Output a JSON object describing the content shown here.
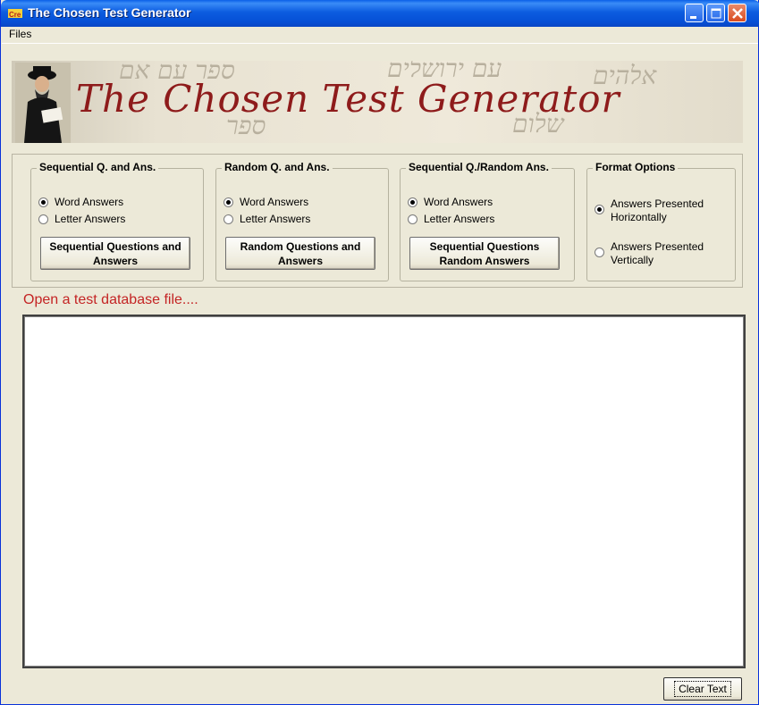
{
  "window": {
    "title": "The Chosen Test Generator"
  },
  "menu": {
    "files": "Files"
  },
  "banner": {
    "title": "The Chosen Test Generator"
  },
  "groups": [
    {
      "legend": "Sequential Q. and Ans.",
      "options": [
        {
          "label": "Word Answers",
          "selected": true
        },
        {
          "label": "Letter Answers",
          "selected": false
        }
      ],
      "button": "Sequential Questions and Answers"
    },
    {
      "legend": "Random Q. and Ans.",
      "options": [
        {
          "label": "Word Answers",
          "selected": true
        },
        {
          "label": "Letter Answers",
          "selected": false
        }
      ],
      "button": "Random Questions and Answers"
    },
    {
      "legend": "Sequential Q./Random Ans.",
      "options": [
        {
          "label": "Word Answers",
          "selected": true
        },
        {
          "label": "Letter Answers",
          "selected": false
        }
      ],
      "button": "Sequential Questions Random Answers"
    }
  ],
  "format": {
    "legend": "Format Options",
    "options": [
      {
        "label": "Answers Presented Horizontally",
        "selected": true
      },
      {
        "label": "Answers Presented Vertically",
        "selected": false
      }
    ]
  },
  "status": "Open a test database file....",
  "output": {
    "text": ""
  },
  "clear_button": "Clear Text",
  "colors": {
    "titlebar": "#0a5fe8",
    "status_text": "#c42424",
    "banner_title": "#8e1b1b",
    "face": "#ece9d8"
  }
}
